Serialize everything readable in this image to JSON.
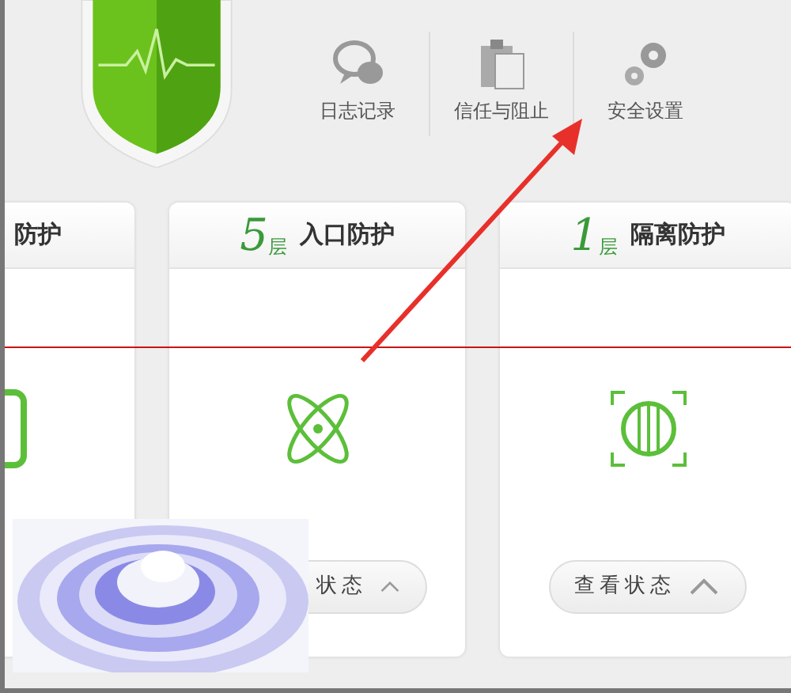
{
  "toolbar": [
    {
      "label": "日志记录",
      "kind": "chat"
    },
    {
      "label": "信任与阻止",
      "kind": "clipboard"
    },
    {
      "label": "安全设置",
      "kind": "gears"
    }
  ],
  "cards": [
    {
      "title": "防护",
      "kind": "square"
    },
    {
      "count": "5",
      "unit": "层",
      "title": "入口防护",
      "kind": "atom",
      "button": "状态",
      "clipped": true
    },
    {
      "count": "1",
      "unit": "层",
      "title": "隔离防护",
      "kind": "grille",
      "button": "查看状态"
    }
  ]
}
